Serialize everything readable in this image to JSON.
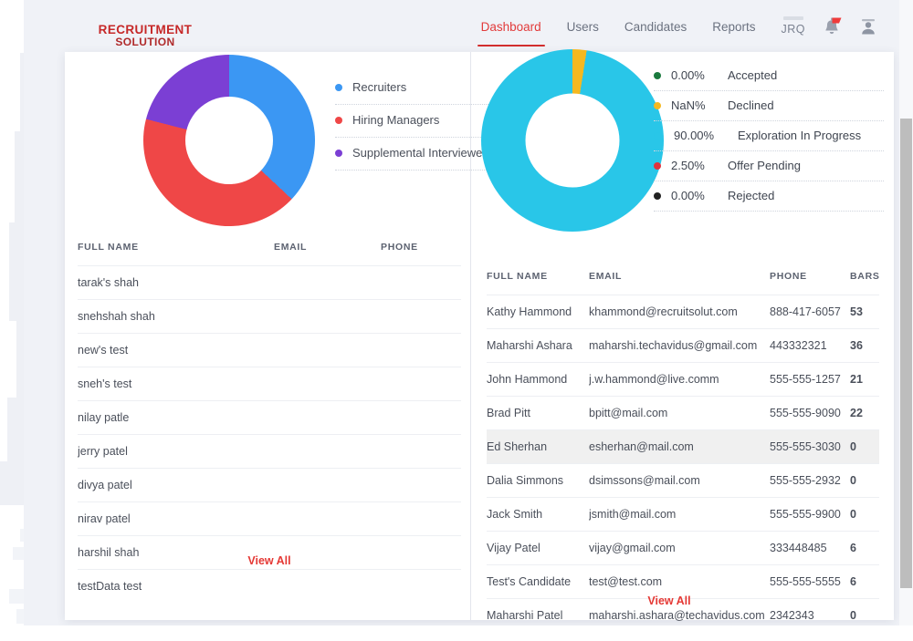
{
  "brand": {
    "line1": "RECRUITMENT",
    "line2": "SOLUTION",
    "color": "#c62828"
  },
  "nav": {
    "items": [
      {
        "label": "Dashboard",
        "active": true
      },
      {
        "label": "Users",
        "active": false
      },
      {
        "label": "Candidates",
        "active": false
      },
      {
        "label": "Reports",
        "active": false
      }
    ],
    "user_initials": "JRQ",
    "icons": [
      "bell-icon",
      "user-avatar-icon"
    ],
    "active_color": "#e23b3b"
  },
  "left_panel": {
    "chart_data": {
      "type": "pie",
      "title": "",
      "legend_position": "right",
      "categories": [
        "Recruiters",
        "Hiring Managers",
        "Supplemental Interviewers"
      ],
      "values": [
        37,
        42,
        21
      ],
      "colors": [
        "#3b97f3",
        "#ef4747",
        "#7b3fd4"
      ],
      "labels": [
        "Recruiters",
        "Hiring Managers",
        "Supplemental Interviewers"
      ]
    },
    "legend": [
      {
        "label": "Recruiters",
        "color": "#3b97f3"
      },
      {
        "label": "Hiring Managers",
        "color": "#ef4747"
      },
      {
        "label": "Supplemental Interviewers",
        "color": "#7b3fd4"
      }
    ],
    "table": {
      "columns": [
        "FULL NAME",
        "EMAIL",
        "PHONE"
      ],
      "rows": [
        {
          "name": "tarak's shah",
          "email": "",
          "phone": ""
        },
        {
          "name": "snehshah shah",
          "email": "",
          "phone": ""
        },
        {
          "name": "new's test",
          "email": "",
          "phone": ""
        },
        {
          "name": "sneh's test",
          "email": "",
          "phone": ""
        },
        {
          "name": "nilay patle",
          "email": "",
          "phone": ""
        },
        {
          "name": "jerry patel",
          "email": "",
          "phone": ""
        },
        {
          "name": "divya patel",
          "email": "",
          "phone": ""
        },
        {
          "name": "nirav patel",
          "email": "",
          "phone": ""
        },
        {
          "name": "harshil shah",
          "email": "",
          "phone": ""
        },
        {
          "name": "testData test",
          "email": "",
          "phone": ""
        }
      ]
    },
    "view_all": "View All"
  },
  "right_panel": {
    "chart_data": {
      "type": "pie",
      "title": "",
      "legend_position": "right",
      "categories": [
        "Accepted",
        "Declined",
        "Exploration In Progress",
        "Offer Pending",
        "Rejected"
      ],
      "values": [
        0.0,
        0.0,
        90.0,
        2.5,
        0.0
      ],
      "display_values": [
        "0.00%",
        "NaN%",
        "90.00%",
        "2.50%",
        "0.00%"
      ],
      "colors": [
        "#1b7a3e",
        "#f5b820",
        "#29c6e8",
        "#e0323c",
        "#222222"
      ]
    },
    "legend": [
      {
        "pct": "0.00%",
        "label": "Accepted",
        "color": "#1b7a3e"
      },
      {
        "pct": "NaN%",
        "label": "Declined",
        "color": "#f5b820"
      },
      {
        "pct": "90.00%",
        "label": "Exploration In Progress",
        "color": "#29c6e8"
      },
      {
        "pct": "2.50%",
        "label": "Offer Pending",
        "color": "#e0323c"
      },
      {
        "pct": "0.00%",
        "label": "Rejected",
        "color": "#222222"
      }
    ],
    "table": {
      "columns": [
        "FULL NAME",
        "EMAIL",
        "PHONE",
        "BARS"
      ],
      "rows": [
        {
          "name": "Kathy Hammond",
          "email": "khammond@recruitsolut.com",
          "phone": "888-417-6057",
          "bars": "53",
          "highlight": false
        },
        {
          "name": "Maharshi Ashara",
          "email": "maharshi.techavidus@gmail.com",
          "phone": "443332321",
          "bars": "36",
          "highlight": false
        },
        {
          "name": "John Hammond",
          "email": "j.w.hammond@live.comm",
          "phone": "555-555-1257",
          "bars": "21",
          "highlight": false
        },
        {
          "name": "Brad Pitt",
          "email": "bpitt@mail.com",
          "phone": "555-555-9090",
          "bars": "22",
          "highlight": false
        },
        {
          "name": "Ed Sherhan",
          "email": "esherhan@mail.com",
          "phone": "555-555-3030",
          "bars": "0",
          "highlight": true
        },
        {
          "name": "Dalia Simmons",
          "email": "dsimssons@mail.com",
          "phone": "555-555-2932",
          "bars": "0",
          "highlight": false
        },
        {
          "name": "Jack Smith",
          "email": "jsmith@mail.com",
          "phone": "555-555-9900",
          "bars": "0",
          "highlight": false
        },
        {
          "name": "Vijay Patel",
          "email": "vijay@gmail.com",
          "phone": "333448485",
          "bars": "6",
          "highlight": false
        },
        {
          "name": "Test's Candidate",
          "email": "test@test.com",
          "phone": "555-555-5555",
          "bars": "6",
          "highlight": false
        },
        {
          "name": "Maharshi Patel",
          "email": "maharshi.ashara@techavidus.com",
          "phone": "2342343",
          "bars": "0",
          "highlight": false
        }
      ]
    },
    "view_all": "View All"
  }
}
